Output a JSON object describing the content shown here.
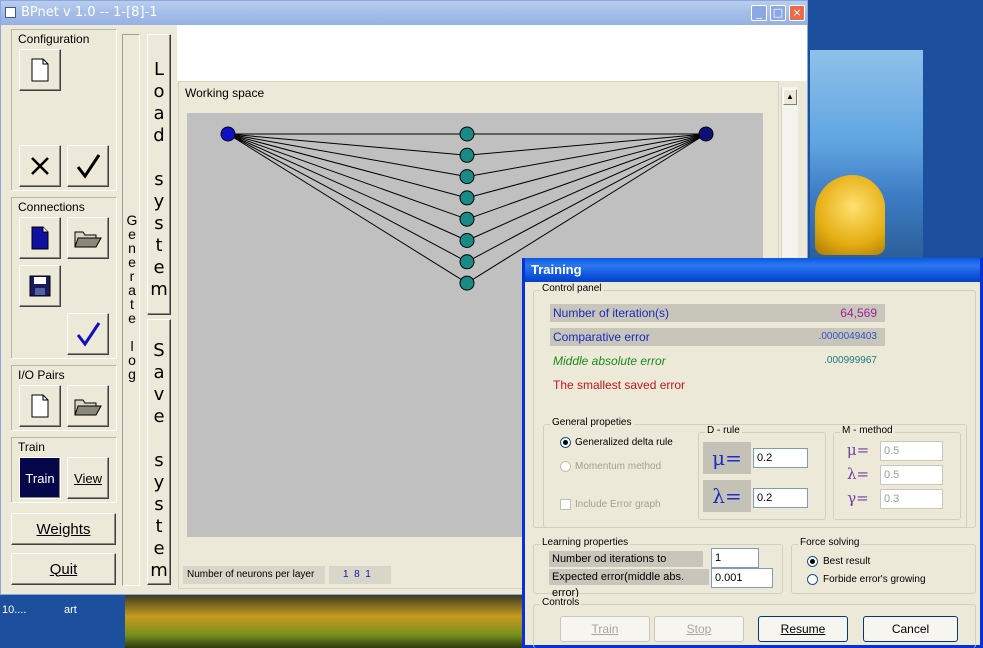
{
  "main_window": {
    "title": "BPnet v 1.0   --   1-[8]-1",
    "buttons": {
      "minimize": "_",
      "maximize": "□",
      "close": "×"
    }
  },
  "configuration": {
    "label": "Configuration"
  },
  "connections": {
    "label": "Connections"
  },
  "io_pairs": {
    "label": "I/O Pairs"
  },
  "train": {
    "label": "Train",
    "train_button": "Train",
    "view_button": "View"
  },
  "weights_button": "Weights",
  "quit_button": "Quit",
  "generate_log": "Generate log",
  "load_system": "Load system",
  "save_system": "Save system",
  "working_space": {
    "label": "Working space",
    "neurons_label": "Number of neurons per layer",
    "neurons_value": "1  8  1",
    "network": {
      "layers": [
        1,
        8,
        1
      ]
    }
  },
  "colors": {
    "input_node": "#1010c8",
    "hidden_node": "#1a8a86",
    "output_node": "#10107a"
  },
  "desktop": {
    "text1": "10....",
    "text2": "art"
  },
  "training": {
    "title": "Training",
    "control_panel": {
      "label": "Control panel",
      "iterations_label": "Number of iteration(s)",
      "iterations_value": "64,569",
      "comparative_label": "Comparative error",
      "comparative_value": ".0000049403",
      "middle_label": "Middle absolute error",
      "middle_value": ".000999967",
      "smallest_label": "The smallest saved error"
    },
    "general": {
      "label": "General propeties",
      "delta_rule": "Generalized delta rule",
      "momentum": "Momentum method",
      "include_error": "Include Error graph"
    },
    "d_rule": {
      "label": "D - rule",
      "mu_symbol": "μ=",
      "mu_value": "0.2",
      "lambda_symbol": "λ=",
      "lambda_value": "0.2"
    },
    "m_method": {
      "label": "M - method",
      "mu_symbol": "μ=",
      "mu_value": "0.5",
      "lambda_symbol": "λ=",
      "lambda_value": "0.5",
      "gamma_symbol": "γ=",
      "gamma_value": "0.3"
    },
    "learning": {
      "label": "Learning properties",
      "refresh_label": "Number od iterations to refresh",
      "refresh_value": "1",
      "expected_label": "Expected error(middle abs. error)",
      "expected_value": "0.001"
    },
    "force": {
      "label": "Force solving",
      "best": "Best result",
      "forbide": "Forbide error's growing"
    },
    "controls": {
      "label": "Controls",
      "train": "Train",
      "stop": "Stop",
      "resume": "Resume",
      "cancel": "Cancel"
    }
  }
}
